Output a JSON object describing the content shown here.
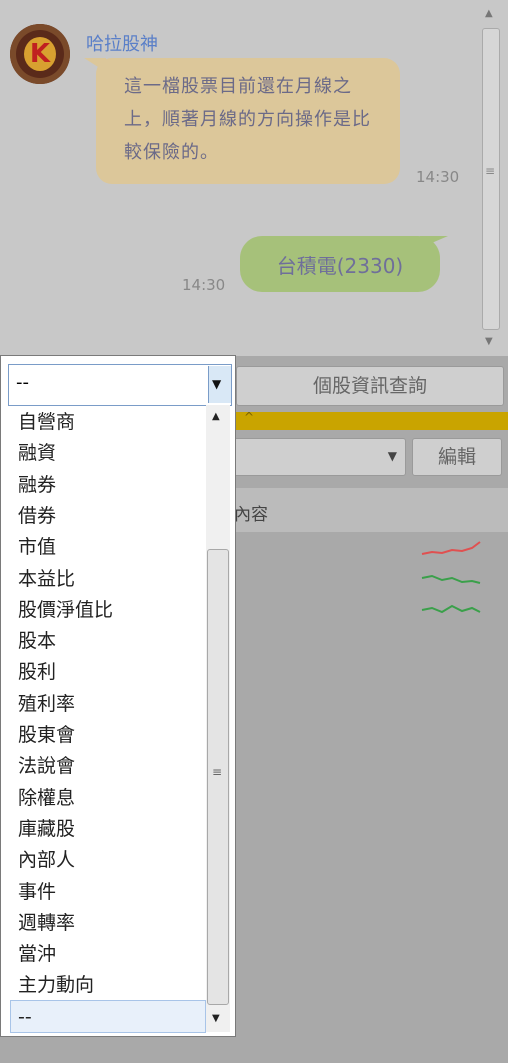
{
  "chat": {
    "sender": "哈拉股神",
    "avatar_letter": "K",
    "message_bot": "這一檔股票目前還在月線之上，順著月線的方向操作是比較保險的。",
    "time_bot": "14:30",
    "message_user": "台積電(2330)",
    "time_user": "14:30"
  },
  "controls": {
    "query_button": "個股資訊查詢",
    "edit_button": "編輯",
    "column_content": "內容"
  },
  "dropdown": {
    "value": "--",
    "options": [
      "自營商",
      "融資",
      "融券",
      "借券",
      "市值",
      "本益比",
      "股價淨值比",
      "股本",
      "股利",
      "殖利率",
      "股東會",
      "法說會",
      "除權息",
      "庫藏股",
      "內部人",
      "事件",
      "週轉率",
      "當沖",
      "主力動向",
      "--"
    ],
    "selected": "--"
  },
  "colors": {
    "spark_red": "#e05050",
    "spark_green": "#3aa04a",
    "bubble_bot": "#dcc79a",
    "bubble_user": "#a6c17a"
  }
}
